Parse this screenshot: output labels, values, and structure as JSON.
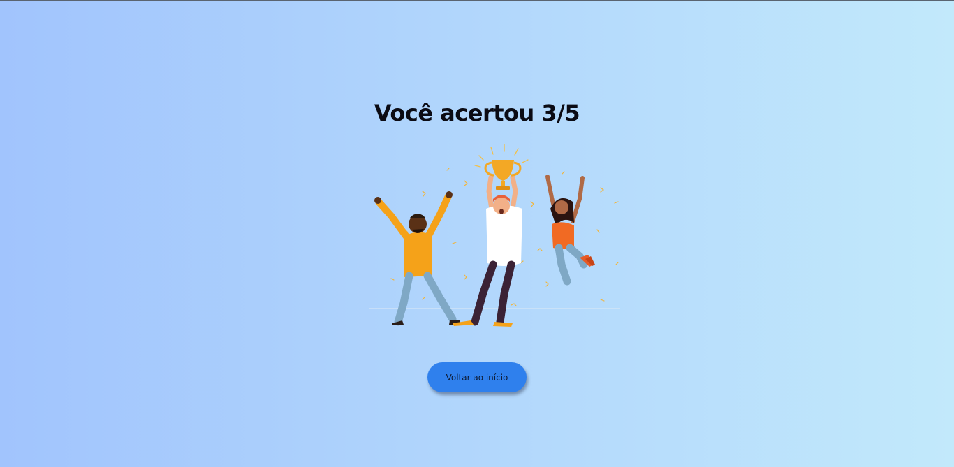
{
  "result": {
    "title": "Você acertou 3/5"
  },
  "illustration": {
    "description_icon": "celebration-trophy-illustration"
  },
  "actions": {
    "back_label": "Voltar ao início"
  },
  "colors": {
    "background_start": "#a1c4fd",
    "background_end": "#c2e9fb",
    "button": "#2f80ed"
  }
}
